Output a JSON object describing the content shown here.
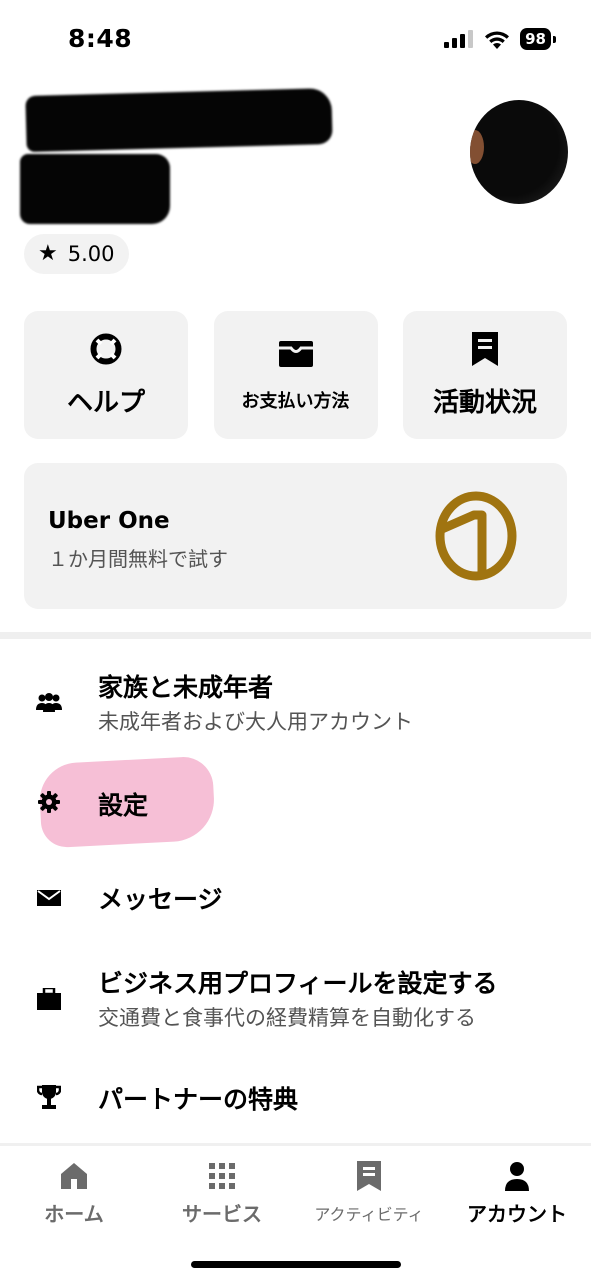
{
  "status_bar": {
    "time": "8:48",
    "battery": "98"
  },
  "profile": {
    "rating": "5.00"
  },
  "quick_actions": [
    {
      "label": "ヘルプ",
      "icon": "lifebuoy-icon"
    },
    {
      "label": "お支払い方法",
      "icon": "wallet-icon"
    },
    {
      "label": "活動状況",
      "icon": "receipt-icon"
    }
  ],
  "promo": {
    "title": "Uber One",
    "subtitle": "１か月間無料で試す",
    "logo_color": "#a07410"
  },
  "menu": {
    "family": {
      "title": "家族と未成年者",
      "subtitle": "未成年者および大人用アカウント"
    },
    "settings": {
      "title": "設定"
    },
    "messages": {
      "title": "メッセージ"
    },
    "business": {
      "title": "ビジネス用プロフィールを設定する",
      "subtitle": "交通費と食事代の経費精算を自動化する"
    },
    "partner": {
      "title": "パートナーの特典"
    }
  },
  "tabs": [
    {
      "label": "ホーム",
      "icon": "home-icon"
    },
    {
      "label": "サービス",
      "icon": "grid-icon"
    },
    {
      "label": "アクティビティ",
      "icon": "receipt-icon"
    },
    {
      "label": "アカウント",
      "icon": "person-icon",
      "active": true
    }
  ],
  "colors": {
    "tile_bg": "#f2f2f2",
    "highlight": "#f6bfd6",
    "muted_text": "#545454",
    "inactive_tab": "#6b6b6b"
  }
}
